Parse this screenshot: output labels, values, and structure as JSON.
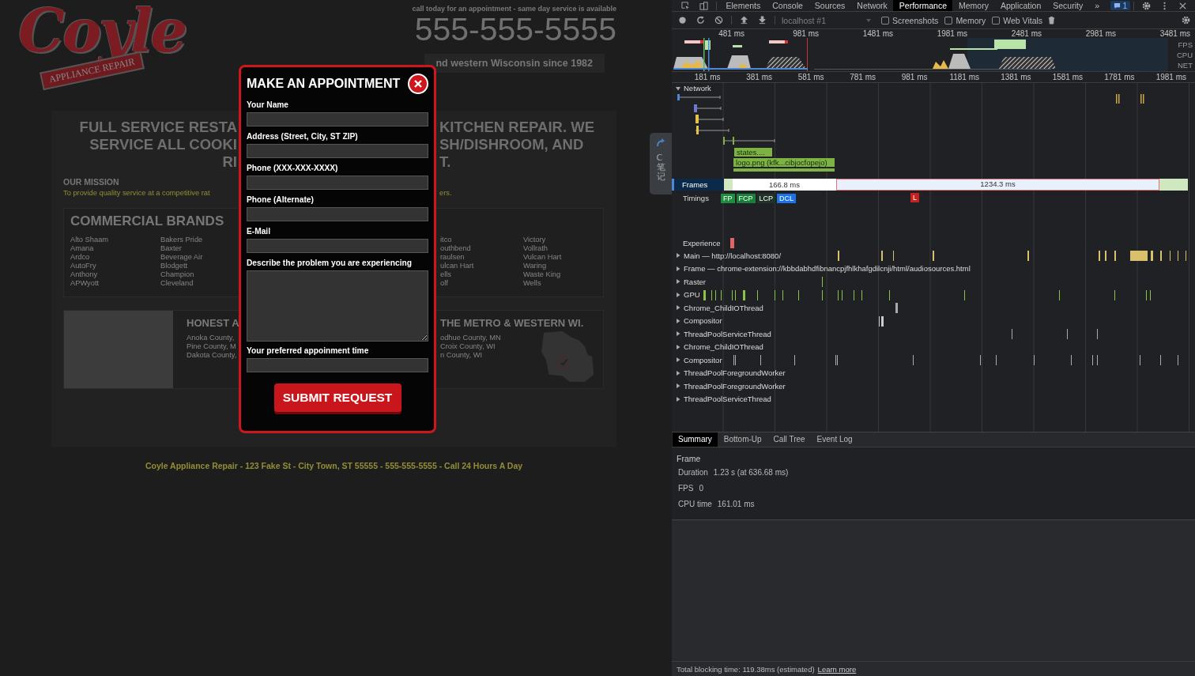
{
  "page": {
    "logo": {
      "script": "Coyle",
      "banner": "APPLIANCE REPAIR"
    },
    "header": {
      "call_note": "call today for an appointment - same day service is available",
      "phone": "555-555-5555"
    },
    "tagline": "nd western Wisconsin since 1982",
    "headline": [
      {
        "left": "FULL SERVICE RESTA",
        "right": "KITCHEN REPAIR. WE"
      },
      {
        "left": "SERVICE ALL COOKI",
        "right": "SH/DISHROOM, AND"
      },
      {
        "left": "RI",
        "right": "T."
      }
    ],
    "mission": {
      "title": "OUR MISSION",
      "left": "To provide quality service at a competitive rat",
      "right": "ers."
    },
    "brands": {
      "title": "COMMERCIAL BRANDS",
      "columns": [
        [
          "Alto Shaam",
          "Amana",
          "Ardco",
          "AutoFry",
          "Anthony",
          "APWyott"
        ],
        [
          "Bakers Pride",
          "Baxter",
          "Beverage Air",
          "Blodgett",
          "Champion",
          "Cleveland"
        ],
        [
          "itco",
          "outhbend",
          "raulsen",
          "ulcan Hart",
          "ells",
          "olf"
        ],
        [
          "Victory",
          "Vollrath",
          "Vulcan Hart",
          "Waring",
          "Waste King",
          "Wells"
        ]
      ]
    },
    "service": {
      "title": "HONEST A",
      "counties": [
        "Anoka County,",
        "Pine County, M",
        "Dakota County,"
      ],
      "right_title": "THE METRO & WESTERN WI.",
      "right_counties": [
        "odhue County, MN",
        "Croix County, WI",
        "n County, WI"
      ]
    },
    "footer": "Coyle Appliance Repair - 123 Fake St - City Town, ST 55555 - 555-555-5555 - Call 24 Hours A Day"
  },
  "side_tab": {
    "label": "C笔记"
  },
  "modal": {
    "title": "MAKE AN APPOINTMENT",
    "fields": [
      {
        "label": "Your Name",
        "kind": "input"
      },
      {
        "label": "Address (Street, City, ST ZIP)",
        "kind": "input"
      },
      {
        "label": "Phone (XXX-XXX-XXXX)",
        "kind": "input"
      },
      {
        "label": "Phone (Alternate)",
        "kind": "input"
      },
      {
        "label": "E-Mail",
        "kind": "input"
      },
      {
        "label": "Describe the problem you are experiencing",
        "kind": "textarea"
      },
      {
        "label": "Your preferred appoinment time",
        "kind": "input"
      }
    ],
    "submit": "SUBMIT REQUEST"
  },
  "devtools": {
    "tabs": [
      {
        "label": "Elements",
        "selected": false
      },
      {
        "label": "Console",
        "selected": false
      },
      {
        "label": "Sources",
        "selected": false
      },
      {
        "label": "Network",
        "selected": false
      },
      {
        "label": "Performance",
        "selected": true
      },
      {
        "label": "Memory",
        "selected": false
      },
      {
        "label": "Application",
        "selected": false
      },
      {
        "label": "Security",
        "selected": false
      }
    ],
    "more_tabs": "»",
    "issues_badge": "1",
    "toolbar": {
      "target": "localhost #1",
      "options": [
        {
          "label": "Screenshots",
          "checked": false
        },
        {
          "label": "Memory",
          "checked": false
        },
        {
          "label": "Web Vitals",
          "checked": false
        }
      ]
    },
    "overview": {
      "time_labels": [
        "481 ms",
        "981 ms",
        "1481 ms",
        "1981 ms",
        "2481 ms",
        "2981 ms",
        "3481 ms"
      ],
      "lanes": [
        "FPS",
        "CPU",
        "NET"
      ]
    },
    "ruler": [
      "181 ms",
      "381 ms",
      "581 ms",
      "781 ms",
      "981 ms",
      "1181 ms",
      "1381 ms",
      "1581 ms",
      "1781 ms",
      "1981 ms"
    ],
    "network": {
      "label": "Network",
      "expanded": true,
      "requests": [
        "states....",
        "logo.png (kfk...cibjocfopejo)"
      ]
    },
    "frames": {
      "label": "Frames",
      "items": [
        {
          "duration": "166.8 ms",
          "selected": false
        },
        {
          "duration": "1234.3 ms",
          "selected": true
        }
      ]
    },
    "timings": {
      "label": "Timings",
      "markers": [
        {
          "label": "FP",
          "color": "#1e8e3e"
        },
        {
          "label": "FCP",
          "color": "#188038"
        },
        {
          "label": "LCP",
          "color": "#1f3327"
        },
        {
          "label": "DCL",
          "color": "#1a73e8"
        }
      ],
      "load_marker": {
        "label": "L",
        "color": "#c5221f"
      }
    },
    "experience": "Experience",
    "threads": [
      {
        "name": "Main — http://localhost:8080/",
        "expanded": false
      },
      {
        "name": "Frame — chrome-extension://kbbdabhdfibnancpjfhlkhafgdilcnji/html/audiosources.html",
        "expanded": false
      },
      {
        "name": "Raster",
        "expanded": false
      },
      {
        "name": "GPU",
        "expanded": false
      },
      {
        "name": "Chrome_ChildIOThread",
        "expanded": false
      },
      {
        "name": "Compositor",
        "expanded": false
      },
      {
        "name": "ThreadPoolServiceThread",
        "expanded": false
      },
      {
        "name": "Chrome_ChildIOThread",
        "expanded": false
      },
      {
        "name": "Compositor",
        "expanded": false
      },
      {
        "name": "ThreadPoolForegroundWorker",
        "expanded": false
      },
      {
        "name": "ThreadPoolForegroundWorker",
        "expanded": false
      },
      {
        "name": "ThreadPoolServiceThread",
        "expanded": false
      }
    ],
    "bottom_tabs": [
      {
        "label": "Summary",
        "selected": true
      },
      {
        "label": "Bottom-Up",
        "selected": false
      },
      {
        "label": "Call Tree",
        "selected": false
      },
      {
        "label": "Event Log",
        "selected": false
      }
    ],
    "summary": {
      "title": "Frame",
      "rows": [
        {
          "key": "Duration",
          "value": "1.23 s (at 636.68 ms)"
        },
        {
          "key": "FPS",
          "value": "0"
        },
        {
          "key": "CPU time",
          "value": "161.01 ms"
        }
      ]
    },
    "status": {
      "text": "Total blocking time: 119.38ms (estimated)",
      "link": "Learn more"
    }
  }
}
